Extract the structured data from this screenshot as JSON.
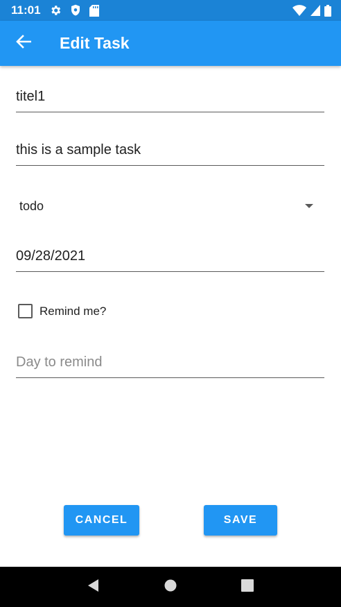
{
  "status_bar": {
    "time": "11:01",
    "icons_left": [
      "settings-icon",
      "shield-icon",
      "sd-card-icon"
    ],
    "icons_right": [
      "wifi-icon",
      "signal-icon",
      "battery-icon"
    ]
  },
  "app_bar": {
    "title": "Edit Task",
    "back_icon": "arrow-left-icon",
    "color": "#2196f3"
  },
  "form": {
    "title_value": "titel1",
    "description_value": "this is a sample task",
    "status_selected": "todo",
    "date_value": "09/28/2021",
    "remind_label": "Remind me?",
    "remind_checked": false,
    "remind_day_placeholder": "Day to remind",
    "remind_day_value": ""
  },
  "actions": {
    "cancel_label": "CANCEL",
    "save_label": "SAVE"
  },
  "nav_bar": {
    "icons": [
      "back-triangle-icon",
      "home-circle-icon",
      "recents-square-icon"
    ]
  }
}
